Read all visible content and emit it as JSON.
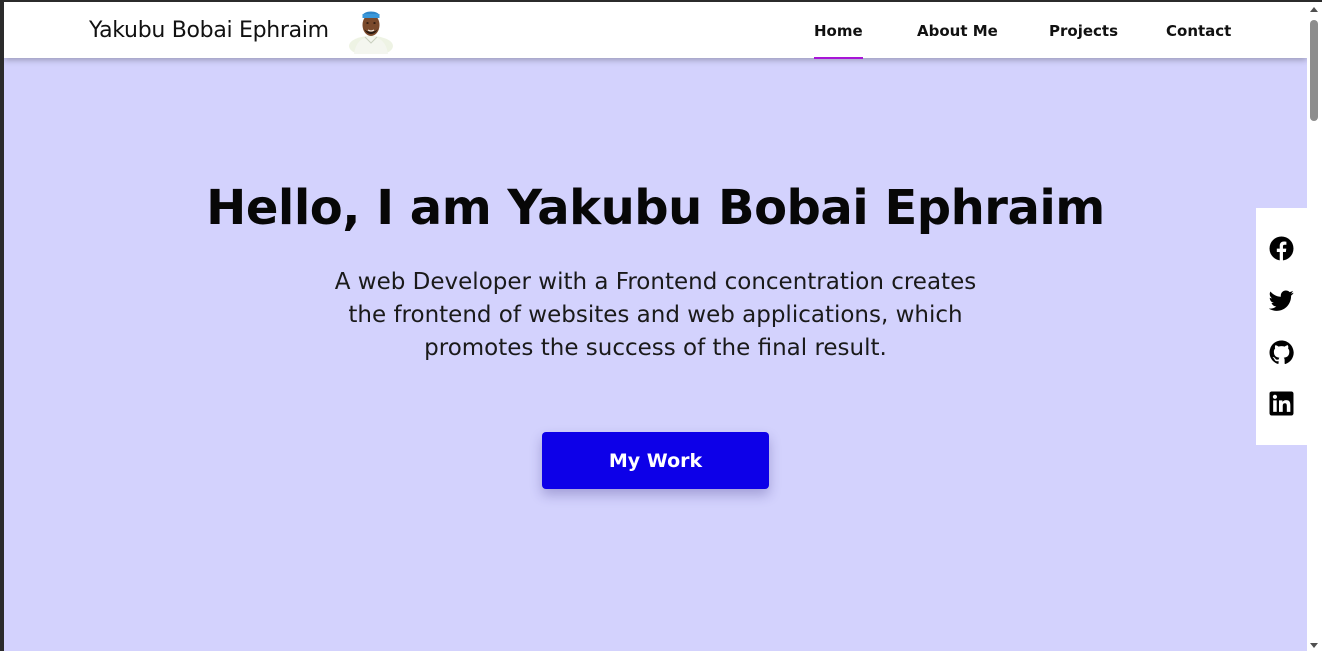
{
  "navbar": {
    "brand": "Yakubu Bobai Ephraim",
    "avatar_icon": "profile-photo",
    "links": [
      {
        "label": "Home",
        "active": true
      },
      {
        "label": "About Me",
        "active": false
      },
      {
        "label": "Projects",
        "active": false
      },
      {
        "label": "Contact",
        "active": false
      }
    ]
  },
  "hero": {
    "title": "Hello, I am Yakubu Bobai Ephraim",
    "subtitle": "A web Developer with a Frontend concentration creates the frontend of websites and web applications, which promotes the success of the final result.",
    "cta_label": "My Work"
  },
  "social": [
    {
      "icon": "facebook-icon"
    },
    {
      "icon": "twitter-icon"
    },
    {
      "icon": "github-icon"
    },
    {
      "icon": "linkedin-icon"
    }
  ],
  "colors": {
    "hero_background": "#d3d2fd",
    "cta_background": "#0d00e8",
    "active_underline": "#a815d6",
    "text_dark": "#070707"
  }
}
